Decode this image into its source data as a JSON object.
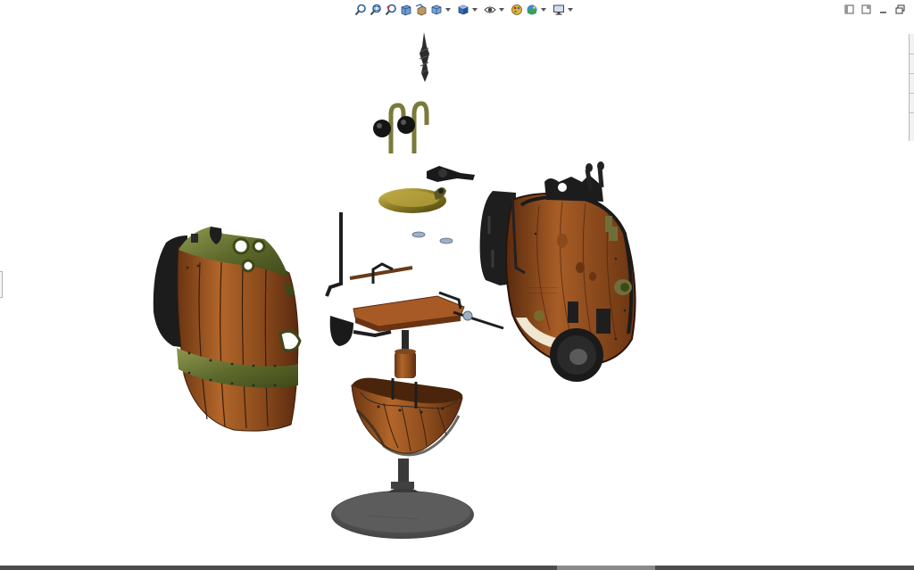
{
  "hud_toolbar": {
    "buttons": [
      {
        "name": "zoom-to-fit-icon"
      },
      {
        "name": "zoom-to-area-icon"
      },
      {
        "name": "previous-view-icon"
      },
      {
        "name": "section-view-icon"
      },
      {
        "name": "dynamic-annotation-views-icon"
      },
      {
        "name": "view-orientation-icon",
        "has_dropdown": true
      },
      {
        "name": "display-style-icon",
        "has_dropdown": true
      },
      {
        "name": "hide-show-items-icon",
        "has_dropdown": true
      },
      {
        "name": "edit-appearance-icon"
      },
      {
        "name": "apply-scene-icon",
        "has_dropdown": true
      },
      {
        "name": "view-settings-icon",
        "has_dropdown": true
      }
    ]
  },
  "window_controls": [
    {
      "name": "restore-pane-icon"
    },
    {
      "name": "tile-window-icon"
    },
    {
      "name": "minimize-icon"
    },
    {
      "name": "maximize-icon"
    }
  ],
  "model": {
    "parts": [
      {
        "name": "drill-bit"
      },
      {
        "name": "handle-pair"
      },
      {
        "name": "lever-arm"
      },
      {
        "name": "hatch-cover"
      },
      {
        "name": "washers"
      },
      {
        "name": "control-rod"
      },
      {
        "name": "seat-assembly"
      },
      {
        "name": "lower-hull"
      },
      {
        "name": "display-stand"
      },
      {
        "name": "left-hull-shell"
      },
      {
        "name": "right-hull-shell"
      }
    ]
  },
  "colors": {
    "background": "#ffffff",
    "wood": "#9a5422",
    "wood_dark": "#5a2c10",
    "brass": "#6e7a3a",
    "metal_dark": "#2a2a2a",
    "stand": "#5a5a5a"
  }
}
